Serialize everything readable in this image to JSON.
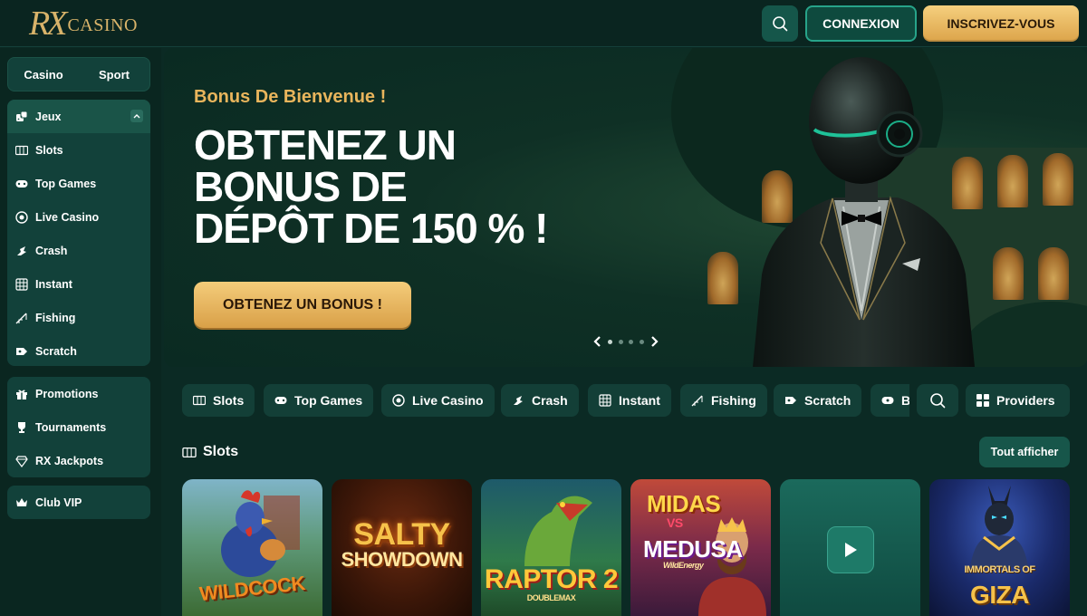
{
  "header": {
    "logo_rx": "RX",
    "logo_casino": "CASINO",
    "search_icon": "search-icon",
    "login_label": "CONNEXION",
    "signup_label": "INSCRIVEZ-VOUS"
  },
  "sidebar": {
    "switch": [
      "Casino",
      "Sport"
    ],
    "games_group": {
      "label": "Jeux",
      "items": [
        {
          "label": "Slots",
          "icon": "slots-icon"
        },
        {
          "label": "Top Games",
          "icon": "top-games-icon"
        },
        {
          "label": "Live Casino",
          "icon": "live-casino-icon"
        },
        {
          "label": "Crash",
          "icon": "crash-icon"
        },
        {
          "label": "Instant",
          "icon": "instant-icon"
        },
        {
          "label": "Fishing",
          "icon": "fishing-icon"
        },
        {
          "label": "Scratch",
          "icon": "scratch-icon"
        }
      ]
    },
    "extras": [
      {
        "label": "Promotions",
        "icon": "gift-icon"
      },
      {
        "label": "Tournaments",
        "icon": "trophy-icon"
      },
      {
        "label": "RX Jackpots",
        "icon": "diamond-icon"
      }
    ],
    "vip": {
      "label": "Club VIP",
      "icon": "crown-icon"
    }
  },
  "hero": {
    "subtitle": "Bonus De Bienvenue !",
    "title_line1": "OBTENEZ UN",
    "title_line2": "BONUS DE",
    "title_line3": "DÉPÔT DE 150 % !",
    "cta": "OBTENEZ UN BONUS !",
    "carousel_slides": 4,
    "carousel_active": 1
  },
  "category_bar": {
    "items": [
      {
        "label": "Slots",
        "icon": "slots-icon"
      },
      {
        "label": "Top Games",
        "icon": "top-games-icon"
      },
      {
        "label": "Live Casino",
        "icon": "live-casino-icon"
      },
      {
        "label": "Crash",
        "icon": "crash-icon"
      },
      {
        "label": "Instant",
        "icon": "instant-icon"
      },
      {
        "label": "Fishing",
        "icon": "fishing-icon"
      },
      {
        "label": "Scratch",
        "icon": "scratch-icon"
      },
      {
        "label": "B",
        "icon": "bonus-icon"
      }
    ],
    "providers_label": "Providers"
  },
  "section": {
    "title": "Slots",
    "see_all": "Tout afficher"
  },
  "games": [
    {
      "title": "WILDCOCK"
    },
    {
      "title_line1": "SALTY",
      "title_line2": "SHOWDOWN"
    },
    {
      "title": "RAPTOR 2",
      "subtitle": "DOUBLEMAX"
    },
    {
      "title_line1": "MIDAS",
      "title_vs": "VS",
      "title_line2": "MEDUSA",
      "subtitle": "WildEnergy"
    },
    {
      "title": ""
    },
    {
      "title_line1": "IMMORTALS OF",
      "title_line2": "GIZA"
    }
  ],
  "colors": {
    "background": "#0b2a24",
    "panel": "#12413a",
    "gold": "#e9b55c",
    "teal_accent": "#27a48a"
  }
}
